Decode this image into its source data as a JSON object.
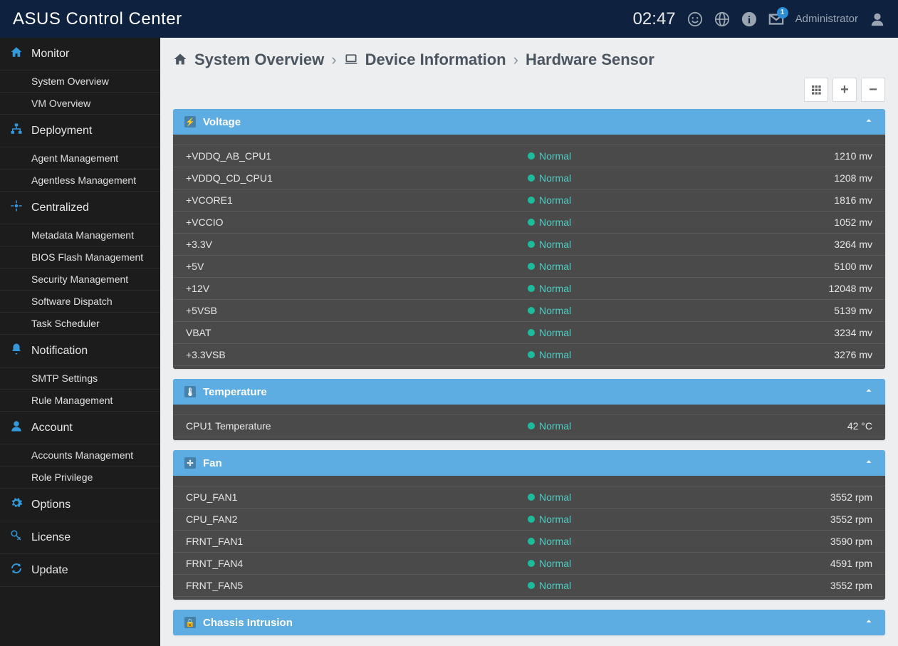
{
  "header": {
    "brand": "ASUS Control Center",
    "clock": "02:47",
    "mail_badge": "1",
    "user": "Administrator"
  },
  "sidebar": {
    "groups": [
      {
        "icon": "home",
        "label": "Monitor",
        "color": "c-blue",
        "items": [
          "System Overview",
          "VM Overview"
        ]
      },
      {
        "icon": "sitemap",
        "label": "Deployment",
        "color": "c-blue",
        "items": [
          "Agent Management",
          "Agentless Management"
        ]
      },
      {
        "icon": "crosshair",
        "label": "Centralized",
        "color": "c-blue",
        "items": [
          "Metadata Management",
          "BIOS Flash Management",
          "Security Management",
          "Software Dispatch",
          "Task Scheduler"
        ]
      },
      {
        "icon": "bell",
        "label": "Notification",
        "color": "c-blue",
        "items": [
          "SMTP Settings",
          "Rule Management"
        ]
      },
      {
        "icon": "user",
        "label": "Account",
        "color": "c-blue",
        "items": [
          "Accounts Management",
          "Role Privilege"
        ]
      },
      {
        "icon": "gear",
        "label": "Options",
        "color": "c-blue",
        "items": []
      },
      {
        "icon": "key",
        "label": "License",
        "color": "c-blue",
        "items": []
      },
      {
        "icon": "refresh",
        "label": "Update",
        "color": "c-blue",
        "items": []
      }
    ]
  },
  "breadcrumb": {
    "l1": "System Overview",
    "l2": "Device Information",
    "l3": "Hardware Sensor"
  },
  "panels": [
    {
      "title": "Voltage",
      "icon": "⚡",
      "rows": [
        {
          "name": "+VDDQ_AB_CPU1",
          "status": "Normal",
          "value": "1210 mv"
        },
        {
          "name": "+VDDQ_CD_CPU1",
          "status": "Normal",
          "value": "1208 mv"
        },
        {
          "name": "+VCORE1",
          "status": "Normal",
          "value": "1816 mv"
        },
        {
          "name": "+VCCIO",
          "status": "Normal",
          "value": "1052 mv"
        },
        {
          "name": "+3.3V",
          "status": "Normal",
          "value": "3264 mv"
        },
        {
          "name": "+5V",
          "status": "Normal",
          "value": "5100 mv"
        },
        {
          "name": "+12V",
          "status": "Normal",
          "value": "12048 mv"
        },
        {
          "name": "+5VSB",
          "status": "Normal",
          "value": "5139 mv"
        },
        {
          "name": "VBAT",
          "status": "Normal",
          "value": "3234 mv"
        },
        {
          "name": "+3.3VSB",
          "status": "Normal",
          "value": "3276 mv"
        }
      ]
    },
    {
      "title": "Temperature",
      "icon": "🌡",
      "rows": [
        {
          "name": "CPU1 Temperature",
          "status": "Normal",
          "value": "42 °C"
        }
      ]
    },
    {
      "title": "Fan",
      "icon": "✢",
      "rows": [
        {
          "name": "CPU_FAN1",
          "status": "Normal",
          "value": "3552 rpm"
        },
        {
          "name": "CPU_FAN2",
          "status": "Normal",
          "value": "3552 rpm"
        },
        {
          "name": "FRNT_FAN1",
          "status": "Normal",
          "value": "3590 rpm"
        },
        {
          "name": "FRNT_FAN4",
          "status": "Normal",
          "value": "4591 rpm"
        },
        {
          "name": "FRNT_FAN5",
          "status": "Normal",
          "value": "3552 rpm"
        }
      ]
    },
    {
      "title": "Chassis Intrusion",
      "icon": "🔒",
      "rows": []
    }
  ]
}
